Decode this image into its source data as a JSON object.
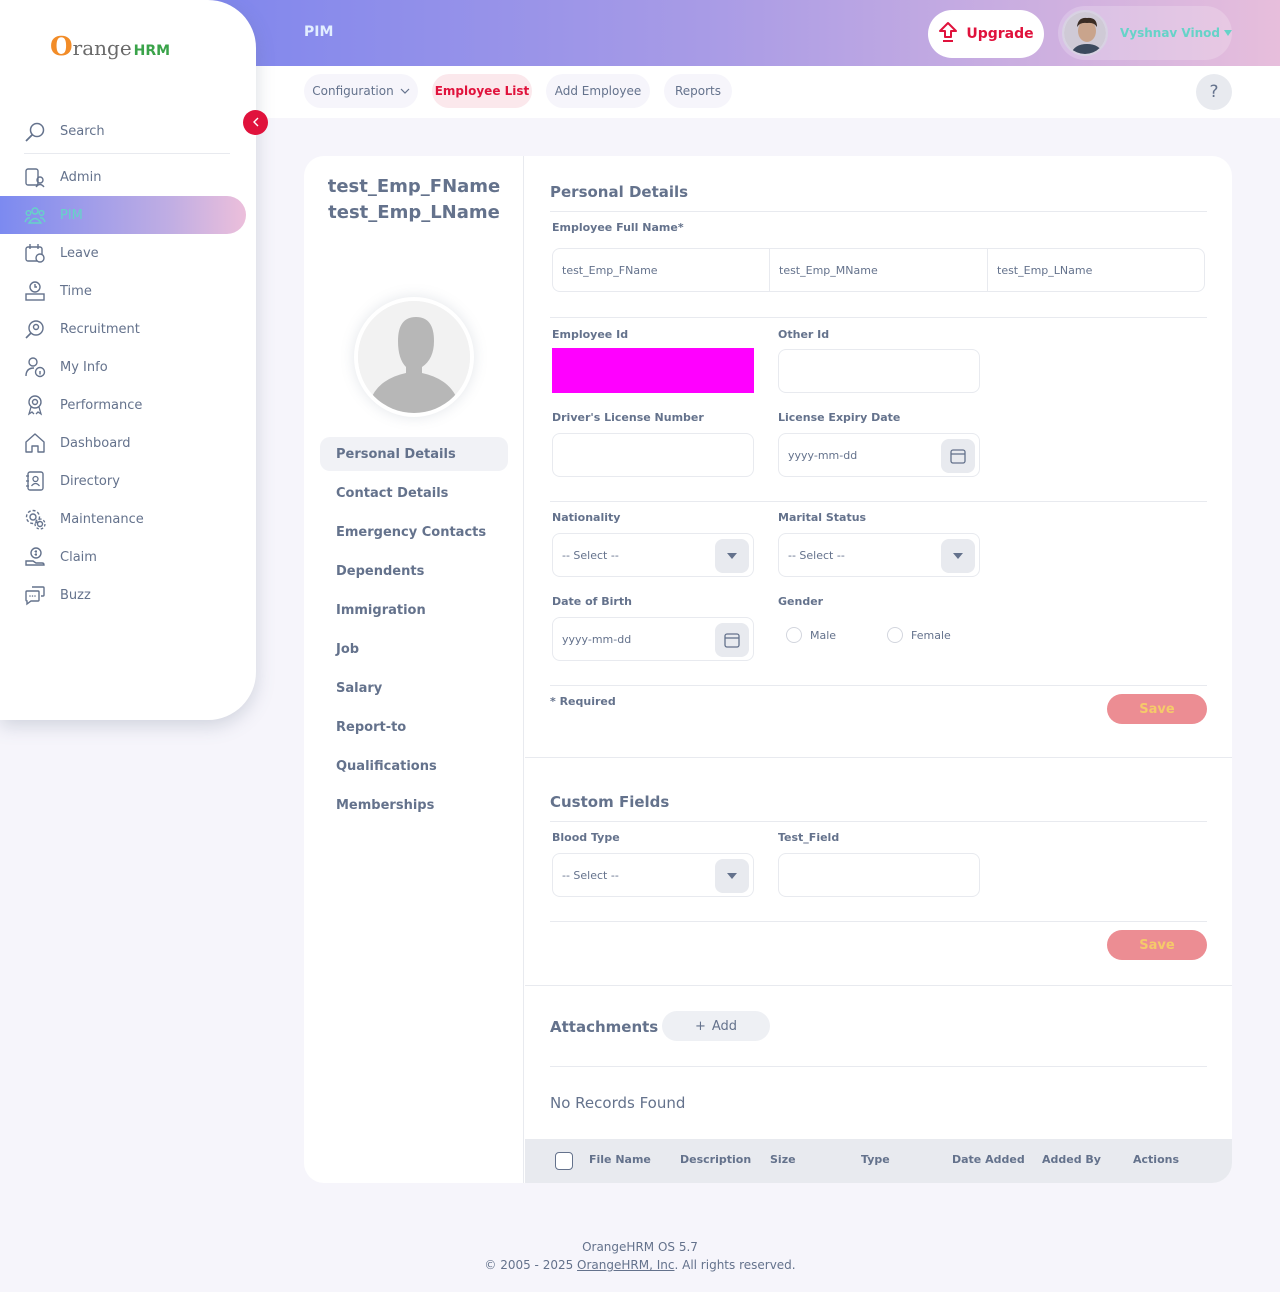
{
  "header": {
    "module_title": "PIM",
    "upgrade_label": "Upgrade",
    "user_name": "Vyshnav Vinod"
  },
  "subnav": {
    "tabs": [
      {
        "label": "Configuration",
        "has_dropdown": true,
        "active": false
      },
      {
        "label": "Employee List",
        "active": true
      },
      {
        "label": "Add Employee",
        "active": false
      },
      {
        "label": "Reports",
        "active": false
      }
    ],
    "help_label": "?"
  },
  "sidebar": {
    "logo_o": "O",
    "logo_range": "range",
    "logo_hrm": "HRM",
    "search_label": "Search",
    "items": [
      {
        "label": "Admin",
        "icon": "admin-icon"
      },
      {
        "label": "PIM",
        "icon": "pim-icon",
        "active": true
      },
      {
        "label": "Leave",
        "icon": "leave-icon"
      },
      {
        "label": "Time",
        "icon": "time-icon"
      },
      {
        "label": "Recruitment",
        "icon": "recruitment-icon"
      },
      {
        "label": "My Info",
        "icon": "my-info-icon"
      },
      {
        "label": "Performance",
        "icon": "performance-icon"
      },
      {
        "label": "Dashboard",
        "icon": "dashboard-icon"
      },
      {
        "label": "Directory",
        "icon": "directory-icon"
      },
      {
        "label": "Maintenance",
        "icon": "maintenance-icon"
      },
      {
        "label": "Claim",
        "icon": "claim-icon"
      },
      {
        "label": "Buzz",
        "icon": "buzz-icon"
      }
    ]
  },
  "employee": {
    "display_name": "test_Emp_FName test_Emp_LName"
  },
  "tabs": [
    {
      "label": "Personal Details",
      "active": true
    },
    {
      "label": "Contact Details"
    },
    {
      "label": "Emergency Contacts"
    },
    {
      "label": "Dependents"
    },
    {
      "label": "Immigration"
    },
    {
      "label": "Job"
    },
    {
      "label": "Salary"
    },
    {
      "label": "Report-to"
    },
    {
      "label": "Qualifications"
    },
    {
      "label": "Memberships"
    }
  ],
  "personal": {
    "title": "Personal Details",
    "full_name_label": "Employee Full Name*",
    "first_name": "test_Emp_FName",
    "middle_name": "test_Emp_MName",
    "last_name": "test_Emp_LName",
    "employee_id_label": "Employee Id",
    "other_id_label": "Other Id",
    "license_label": "Driver's License Number",
    "license_expiry_label": "License Expiry Date",
    "date_placeholder": "yyyy-mm-dd",
    "nationality_label": "Nationality",
    "marital_label": "Marital Status",
    "select_placeholder": "-- Select --",
    "dob_label": "Date of Birth",
    "gender_label": "Gender",
    "gender_male": "Male",
    "gender_female": "Female",
    "required_note": "* Required",
    "save_label": "Save"
  },
  "custom": {
    "title": "Custom Fields",
    "blood_type_label": "Blood Type",
    "test_field_label": "Test_Field",
    "select_placeholder": "-- Select --",
    "save_label": "Save"
  },
  "attachments": {
    "title": "Attachments",
    "add_label": "Add",
    "empty_message": "No Records Found",
    "columns": [
      "File Name",
      "Description",
      "Size",
      "Type",
      "Date Added",
      "Added By",
      "Actions"
    ]
  },
  "footer": {
    "version": "OrangeHRM OS 5.7",
    "copyright_prefix": "© 2005 - 2025 ",
    "company_link": "OrangeHRM, Inc",
    "copyright_suffix": ". All rights reserved."
  },
  "colors": {
    "accent": "#e0123c",
    "active_menu_text": "#66d3c8",
    "text": "#64728c",
    "masked_field": "#ff00ff"
  }
}
